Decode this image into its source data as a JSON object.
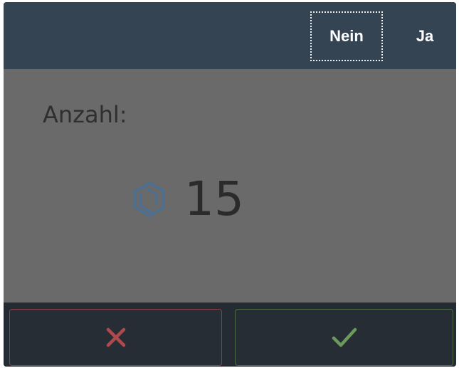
{
  "header": {
    "no_label": "Nein",
    "yes_label": "Ja"
  },
  "content": {
    "quantity_label": "Anzahl:",
    "quantity_value": "15",
    "quantity_icon": "package-box-icon"
  },
  "footer": {
    "cancel_icon": "close-icon",
    "confirm_icon": "checkmark-icon"
  },
  "colors": {
    "header_bg": "#354453",
    "content_bg": "#6a6a6a",
    "footer_bg": "#252b32",
    "cancel_accent": "#b0494d",
    "confirm_accent": "#6b9a5c",
    "icon_blue": "#4f6f8d"
  }
}
